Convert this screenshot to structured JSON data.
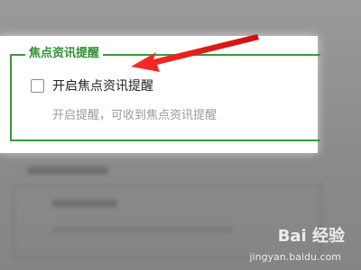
{
  "section": {
    "legend": "焦点资讯提醒",
    "option_label": "开启焦点资讯提醒",
    "option_hint": "开启提醒，可收到焦点资讯提醒",
    "checked": false
  },
  "colors": {
    "accent_green": "#3a9a3a",
    "arrow_red": "#e02020"
  },
  "watermark": {
    "brand": "Bai 经验",
    "url": "jingyan.baidu.com"
  }
}
